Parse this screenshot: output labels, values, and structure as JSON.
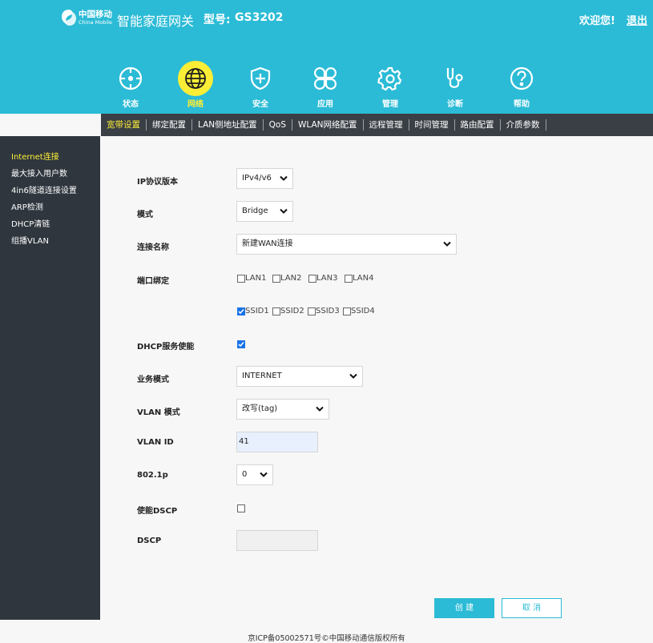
{
  "header": {
    "logo_cn": "中国移动",
    "logo_en": "China Mobile",
    "app_title": "智能家庭网关",
    "model_label": "型号:",
    "model_value": "GS3202",
    "welcome": "欢迎您!",
    "logout": "退出",
    "brand_color": "#2bbbd6",
    "active_color": "#fcee36"
  },
  "nav": [
    {
      "label": "状态",
      "icon": "crosshair-icon",
      "active": false
    },
    {
      "label": "网络",
      "icon": "globe-icon",
      "active": true
    },
    {
      "label": "安全",
      "icon": "shield-plus-icon",
      "active": false
    },
    {
      "label": "应用",
      "icon": "clover-icon",
      "active": false
    },
    {
      "label": "管理",
      "icon": "gear-icon",
      "active": false
    },
    {
      "label": "诊断",
      "icon": "stethoscope-icon",
      "active": false
    },
    {
      "label": "帮助",
      "icon": "question-icon",
      "active": false
    }
  ],
  "subnav": [
    {
      "label": "宽带设置",
      "active": true
    },
    {
      "label": "绑定配置",
      "active": false
    },
    {
      "label": "LAN侧地址配置",
      "active": false
    },
    {
      "label": "QoS",
      "active": false
    },
    {
      "label": "WLAN网络配置",
      "active": false
    },
    {
      "label": "远程管理",
      "active": false
    },
    {
      "label": "时间管理",
      "active": false
    },
    {
      "label": "路由配置",
      "active": false
    },
    {
      "label": "介质参数",
      "active": false
    }
  ],
  "sidebar": [
    {
      "label": "Internet连接",
      "active": true
    },
    {
      "label": "最大接入用户数",
      "active": false
    },
    {
      "label": "4in6隧道连接设置",
      "active": false
    },
    {
      "label": "ARP检测",
      "active": false
    },
    {
      "label": "DHCP清链",
      "active": false
    },
    {
      "label": "组播VLAN",
      "active": false
    }
  ],
  "form": {
    "ip_version": {
      "label": "IP协议版本",
      "value": "IPv4/v6"
    },
    "mode": {
      "label": "模式",
      "value": "Bridge"
    },
    "conn_name": {
      "label": "连接名称",
      "value": "新建WAN连接"
    },
    "port_binding": {
      "label": "端口绑定",
      "lan": [
        {
          "label": "LAN1",
          "checked": false
        },
        {
          "label": "LAN2",
          "checked": false
        },
        {
          "label": "LAN3",
          "checked": false
        },
        {
          "label": "LAN4",
          "checked": false
        }
      ],
      "ssid": [
        {
          "label": "SSID1",
          "checked": true
        },
        {
          "label": "SSID2",
          "checked": false
        },
        {
          "label": "SSID3",
          "checked": false
        },
        {
          "label": "SSID4",
          "checked": false
        }
      ]
    },
    "dhcp": {
      "label": "DHCP服务使能",
      "checked": true
    },
    "service_mode": {
      "label": "业务模式",
      "value": "INTERNET"
    },
    "vlan_mode": {
      "label": "VLAN 模式",
      "value": "改写(tag)"
    },
    "vlan_id": {
      "label": "VLAN ID",
      "value": "41"
    },
    "priority": {
      "label": "802.1p",
      "value": "0"
    },
    "dscp_enable": {
      "label": "使能DSCP",
      "checked": false
    },
    "dscp": {
      "label": "DSCP",
      "value": ""
    }
  },
  "buttons": {
    "create": "创 建",
    "cancel": "取 消"
  },
  "footer": {
    "text": "京ICP备05002571号©中国移动通信版权所有"
  }
}
